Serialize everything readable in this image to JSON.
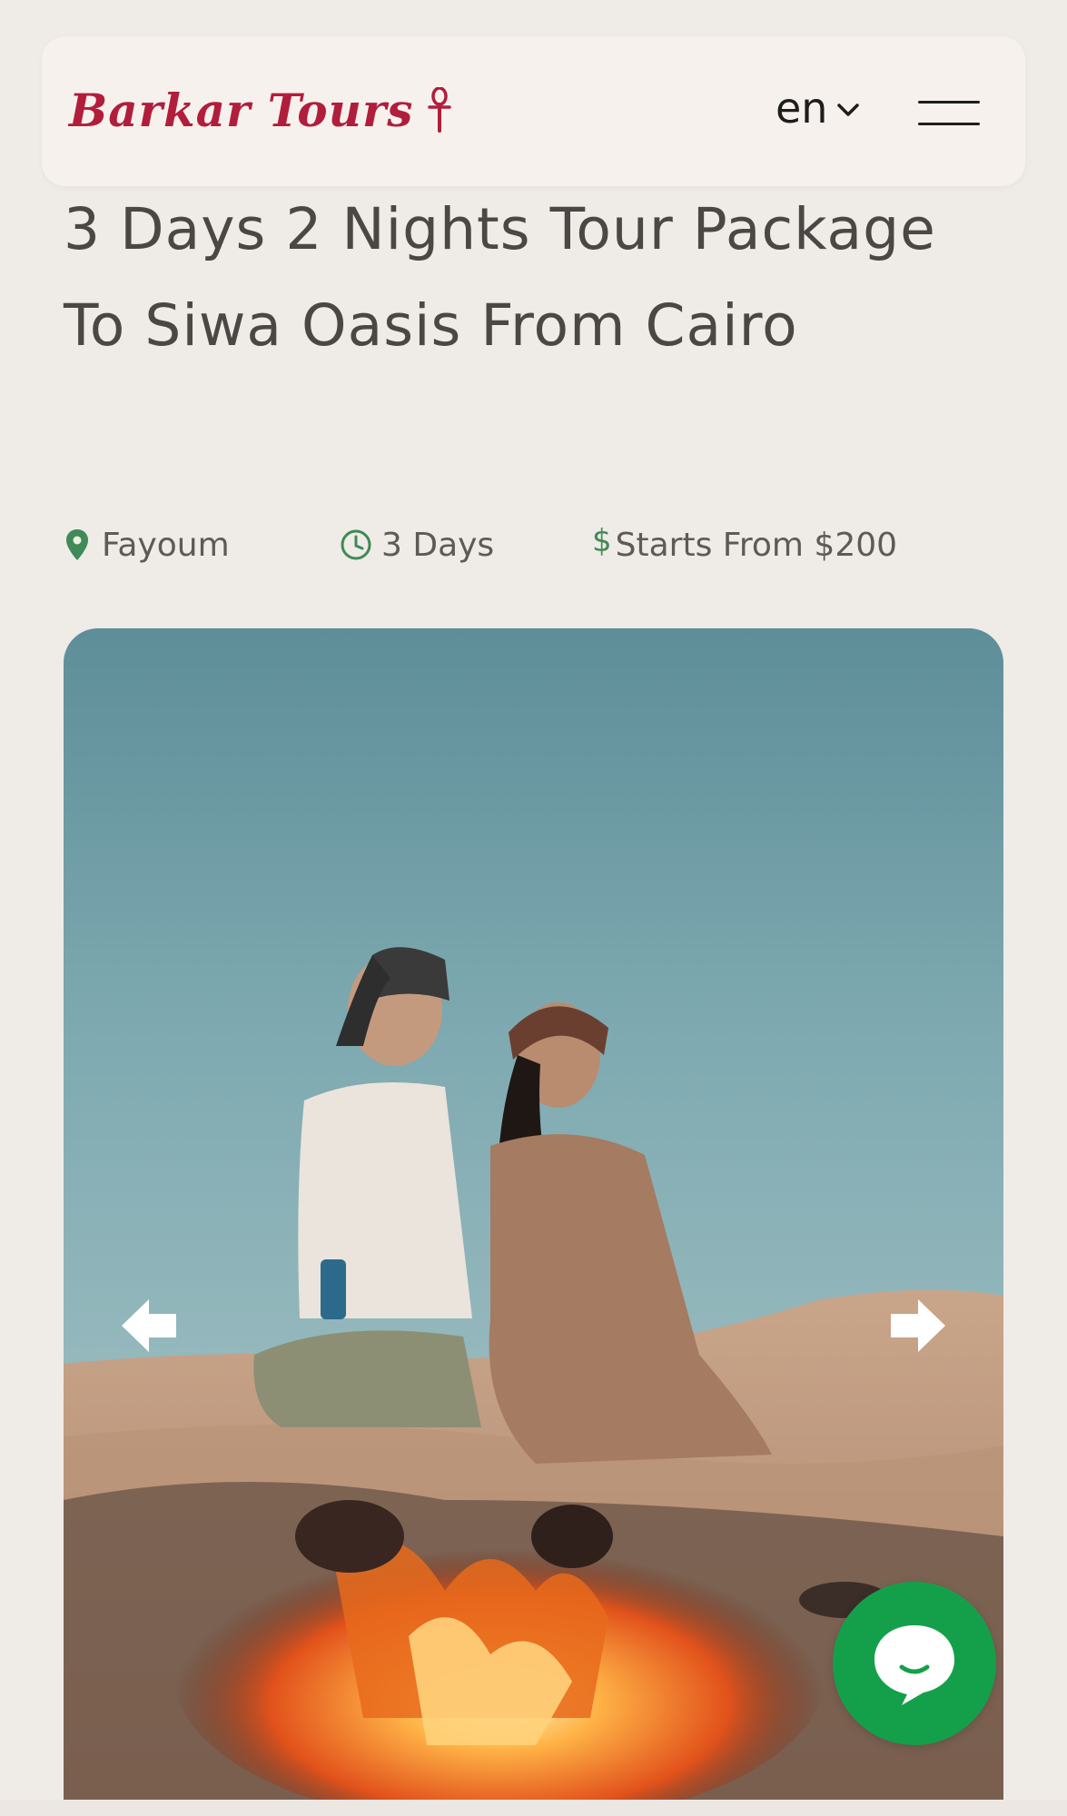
{
  "header": {
    "logo_text": "Barkar Tours",
    "language": "en",
    "menu_icon": "hamburger-menu-icon"
  },
  "tour": {
    "title": "3 Days 2 Nights Tour Package To Siwa Oasis From Cairo",
    "location": "Fayoum",
    "duration": "3 Days",
    "price": "Starts From $200"
  },
  "icons": {
    "location": "map-pin-icon",
    "duration": "clock-icon",
    "price": "dollar-icon",
    "prev": "arrow-left-icon",
    "next": "arrow-right-icon",
    "chat": "chat-bubble-icon"
  },
  "colors": {
    "brand": "#b11e3c",
    "accent_green": "#3f8a57",
    "chat_button": "#14a04a",
    "background": "#efebe7"
  }
}
